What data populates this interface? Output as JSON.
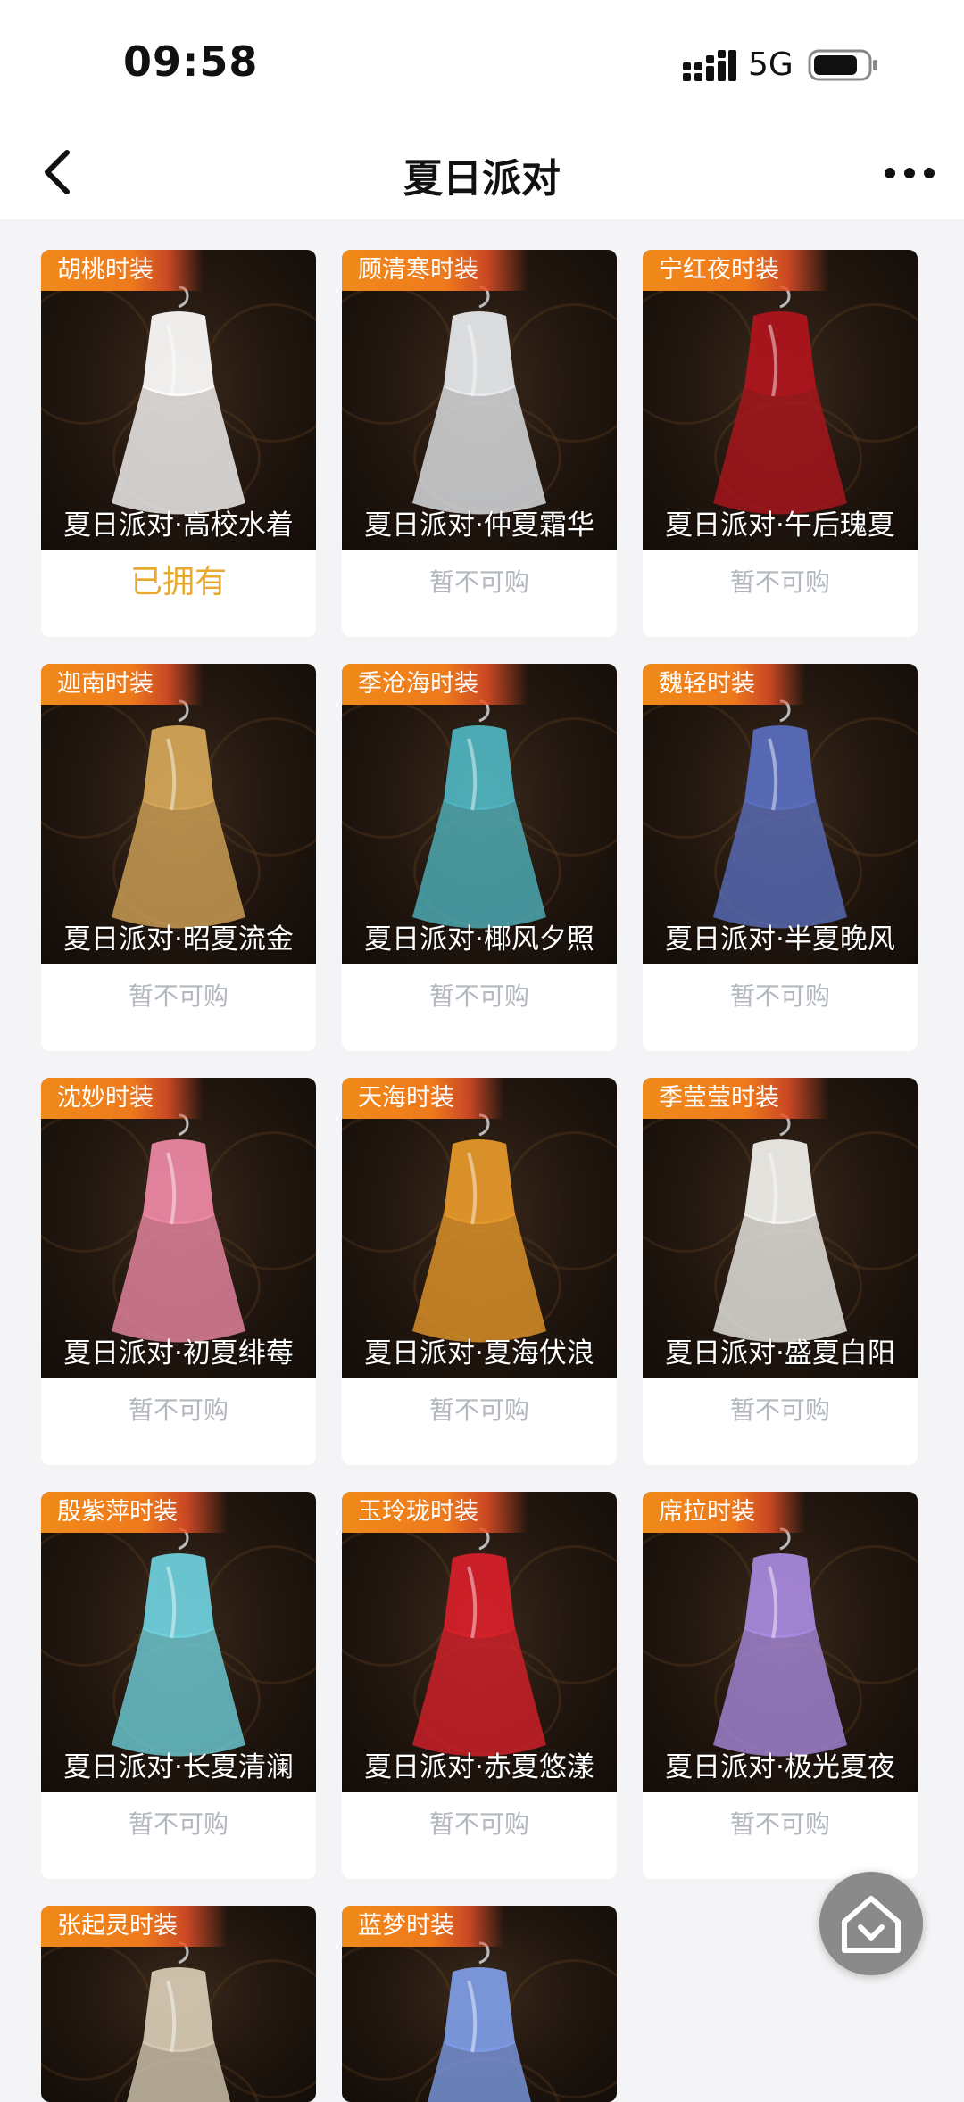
{
  "status_bar": {
    "time": "09:58",
    "network": "5G"
  },
  "nav": {
    "title": "夏日派对"
  },
  "cards": [
    {
      "character": "胡桃时装",
      "outfit": "夏日派对·高校水着",
      "status": "已拥有",
      "owned": true,
      "accent": "#ffffff"
    },
    {
      "character": "顾清寒时装",
      "outfit": "夏日派对·仲夏霜华",
      "status": "暂不可购",
      "owned": false,
      "accent": "#e8ecef"
    },
    {
      "character": "宁红夜时装",
      "outfit": "夏日派对·午后瑰夏",
      "status": "暂不可购",
      "owned": false,
      "accent": "#b0151c"
    },
    {
      "character": "迦南时装",
      "outfit": "夏日派对·昭夏流金",
      "status": "暂不可购",
      "owned": false,
      "accent": "#d7a85a"
    },
    {
      "character": "季沧海时装",
      "outfit": "夏日派对·椰风夕照",
      "status": "暂不可购",
      "owned": false,
      "accent": "#4fb6c2"
    },
    {
      "character": "魏轻时装",
      "outfit": "夏日派对·半夏晚风",
      "status": "暂不可购",
      "owned": false,
      "accent": "#5a6fc0"
    },
    {
      "character": "沈妙时装",
      "outfit": "夏日派对·初夏绯莓",
      "status": "暂不可购",
      "owned": false,
      "accent": "#f08aa8"
    },
    {
      "character": "天海时装",
      "outfit": "夏日派对·夏海伏浪",
      "status": "暂不可购",
      "owned": false,
      "accent": "#e89a2a"
    },
    {
      "character": "季莹莹时装",
      "outfit": "夏日派对·盛夏白阳",
      "status": "暂不可购",
      "owned": false,
      "accent": "#f2f2ee"
    },
    {
      "character": "殷紫萍时装",
      "outfit": "夏日派对·长夏清澜",
      "status": "暂不可购",
      "owned": false,
      "accent": "#6fd3df"
    },
    {
      "character": "玉玲珑时装",
      "outfit": "夏日派对·赤夏悠漾",
      "status": "暂不可购",
      "owned": false,
      "accent": "#d8202a"
    },
    {
      "character": "席拉时装",
      "outfit": "夏日派对·极光夏夜",
      "status": "暂不可购",
      "owned": false,
      "accent": "#a98be0"
    },
    {
      "character": "张起灵时装",
      "outfit": "",
      "status": "",
      "owned": false,
      "accent": "#d9cdb6"
    },
    {
      "character": "蓝梦时装",
      "outfit": "",
      "status": "",
      "owned": false,
      "accent": "#7f9ee8"
    }
  ]
}
